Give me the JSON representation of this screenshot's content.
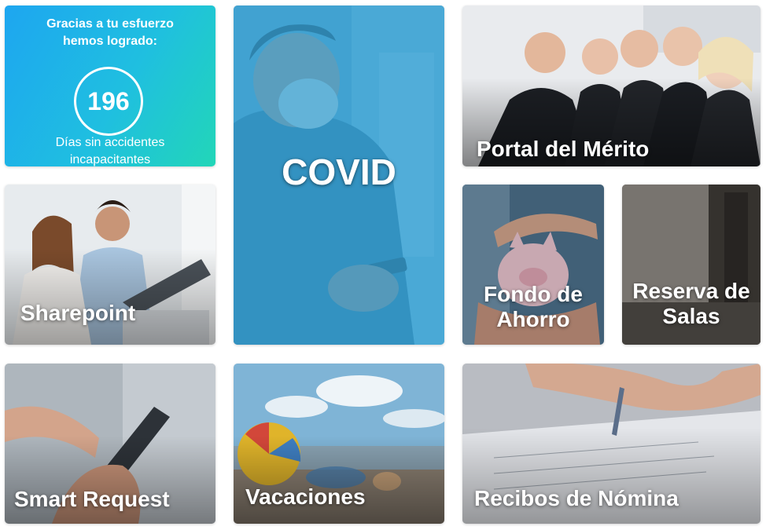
{
  "counter": {
    "line1": "Gracias a tu esfuerzo",
    "line2": "hemos logrado:",
    "days": "196",
    "line3": "Días sin accidentes",
    "line4": "incapacitantes"
  },
  "tiles": {
    "covid": "COVID",
    "merito": "Portal del Mérito",
    "sharepoint": "Sharepoint",
    "fondo_l1": "Fondo de",
    "fondo_l2": "Ahorro",
    "salas_l1": "Reserva de",
    "salas_l2": "Salas",
    "smart": "Smart Request",
    "vacaciones": "Vacaciones",
    "nomina": "Recibos de Nómina"
  },
  "colors": {
    "counter_gradient_start": "#1ea6f0",
    "counter_gradient_end": "#22d6b8",
    "covid_overlay": "#2f9fd6"
  }
}
